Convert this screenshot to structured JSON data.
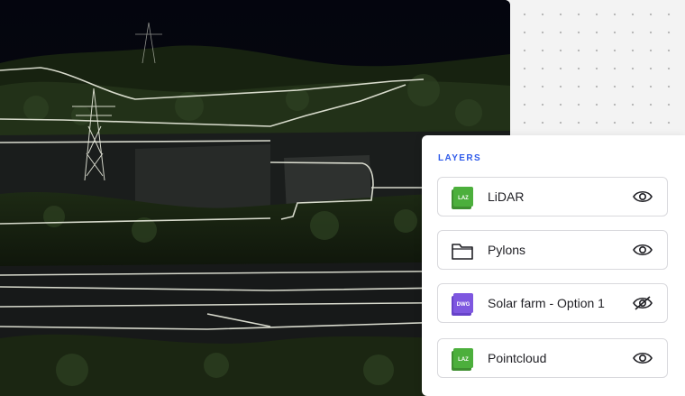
{
  "viewer": {
    "scene": "3d-map-view"
  },
  "layers_panel": {
    "title": "LAYERS",
    "items": [
      {
        "label": "LiDAR",
        "icon": "laz-file-icon",
        "badge": "LAZ",
        "badge_color": "#4caf3c",
        "visible": true
      },
      {
        "label": "Pylons",
        "icon": "folder-icon",
        "badge": "",
        "badge_color": "",
        "visible": true
      },
      {
        "label": "Solar farm - Option 1",
        "icon": "dwg-file-icon",
        "badge": "DWG",
        "badge_color": "#7e57e0",
        "visible": false
      },
      {
        "label": "Pointcloud",
        "icon": "laz-file-icon",
        "badge": "LAZ",
        "badge_color": "#4caf3c",
        "visible": true
      }
    ]
  },
  "colors": {
    "accent": "#2f5bea",
    "viewer_bg": "#05060f",
    "overlay_lines": "#e8eadc"
  }
}
